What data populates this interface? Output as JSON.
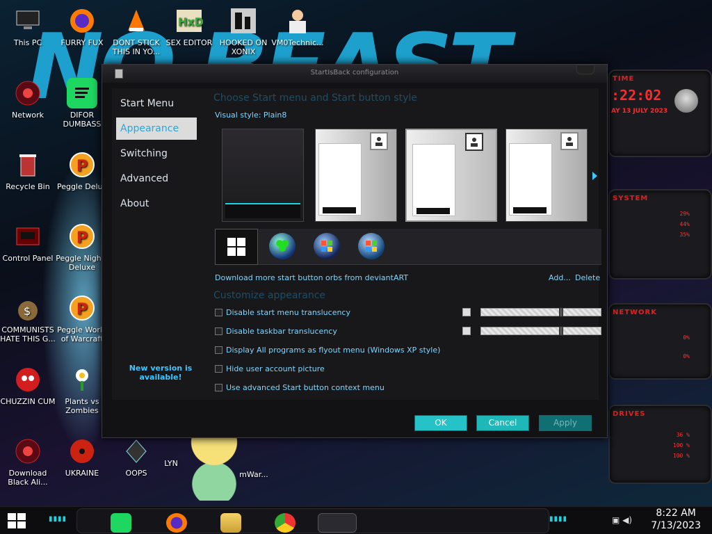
{
  "desktop": {
    "icons": [
      {
        "label": "This PC"
      },
      {
        "label": "FURRY FUX"
      },
      {
        "label": "DONT STICK THIS IN YO..."
      },
      {
        "label": "SEX EDITOR"
      },
      {
        "label": "HOOKED ON XONIX"
      },
      {
        "label": "VM0Technic..."
      },
      {
        "label": "Network"
      },
      {
        "label": "DIFOR DUMBASS"
      },
      {
        "label": "Recycle Bin"
      },
      {
        "label": "Peggle Delux"
      },
      {
        "label": "Control Panel"
      },
      {
        "label": "Peggle Nights Deluxe"
      },
      {
        "label": "COMMUNISTS HATE THIS G..."
      },
      {
        "label": "Peggle World of Warcraft"
      },
      {
        "label": "CHUZZIN CUM"
      },
      {
        "label": "Plants vs Zombies"
      },
      {
        "label": "Download Black Ali..."
      },
      {
        "label": "UKRAINE"
      },
      {
        "label": "OOPS"
      },
      {
        "label": "LYN"
      },
      {
        "label": "mWar..."
      }
    ]
  },
  "dialog": {
    "title": "StartIsBack configuration",
    "nav": [
      "Start Menu",
      "Appearance",
      "Switching",
      "Advanced",
      "About"
    ],
    "active_nav": "Appearance",
    "new_version": "New version is available!",
    "heading_style": "Choose Start menu and Start button style",
    "visual_style_label": "Visual style:",
    "visual_style_value": "Plain8",
    "download_orbs": "Download more start button orbs from deviantART",
    "add_label": "Add...",
    "delete_label": "Delete",
    "heading_customize": "Customize appearance",
    "options": [
      {
        "label": "Disable start menu translucency",
        "checked": false
      },
      {
        "label": "Disable taskbar translucency",
        "checked": false
      },
      {
        "label": "Display All programs as flyout menu (Windows XP style)",
        "checked": false
      },
      {
        "label": "Hide user account picture",
        "checked": false
      },
      {
        "label": "Use advanced Start button context menu",
        "checked": false
      }
    ],
    "buttons": {
      "ok": "OK",
      "cancel": "Cancel",
      "apply": "Apply"
    }
  },
  "widgets": {
    "time_title": "TIME",
    "time_value": ":22:02",
    "date_value": "AY 13 JULY 2023",
    "system_title": "SYSTEM",
    "system_values": [
      "29%",
      "44%",
      "35%"
    ],
    "network_title": "NETWORK",
    "network_values": [
      "0%",
      "0%"
    ],
    "drives_title": "DRIVES",
    "drives_values": [
      "36 %",
      "100 %",
      "100 %"
    ]
  },
  "taskbar": {
    "time": "8:22 AM",
    "date": "7/13/2023"
  }
}
